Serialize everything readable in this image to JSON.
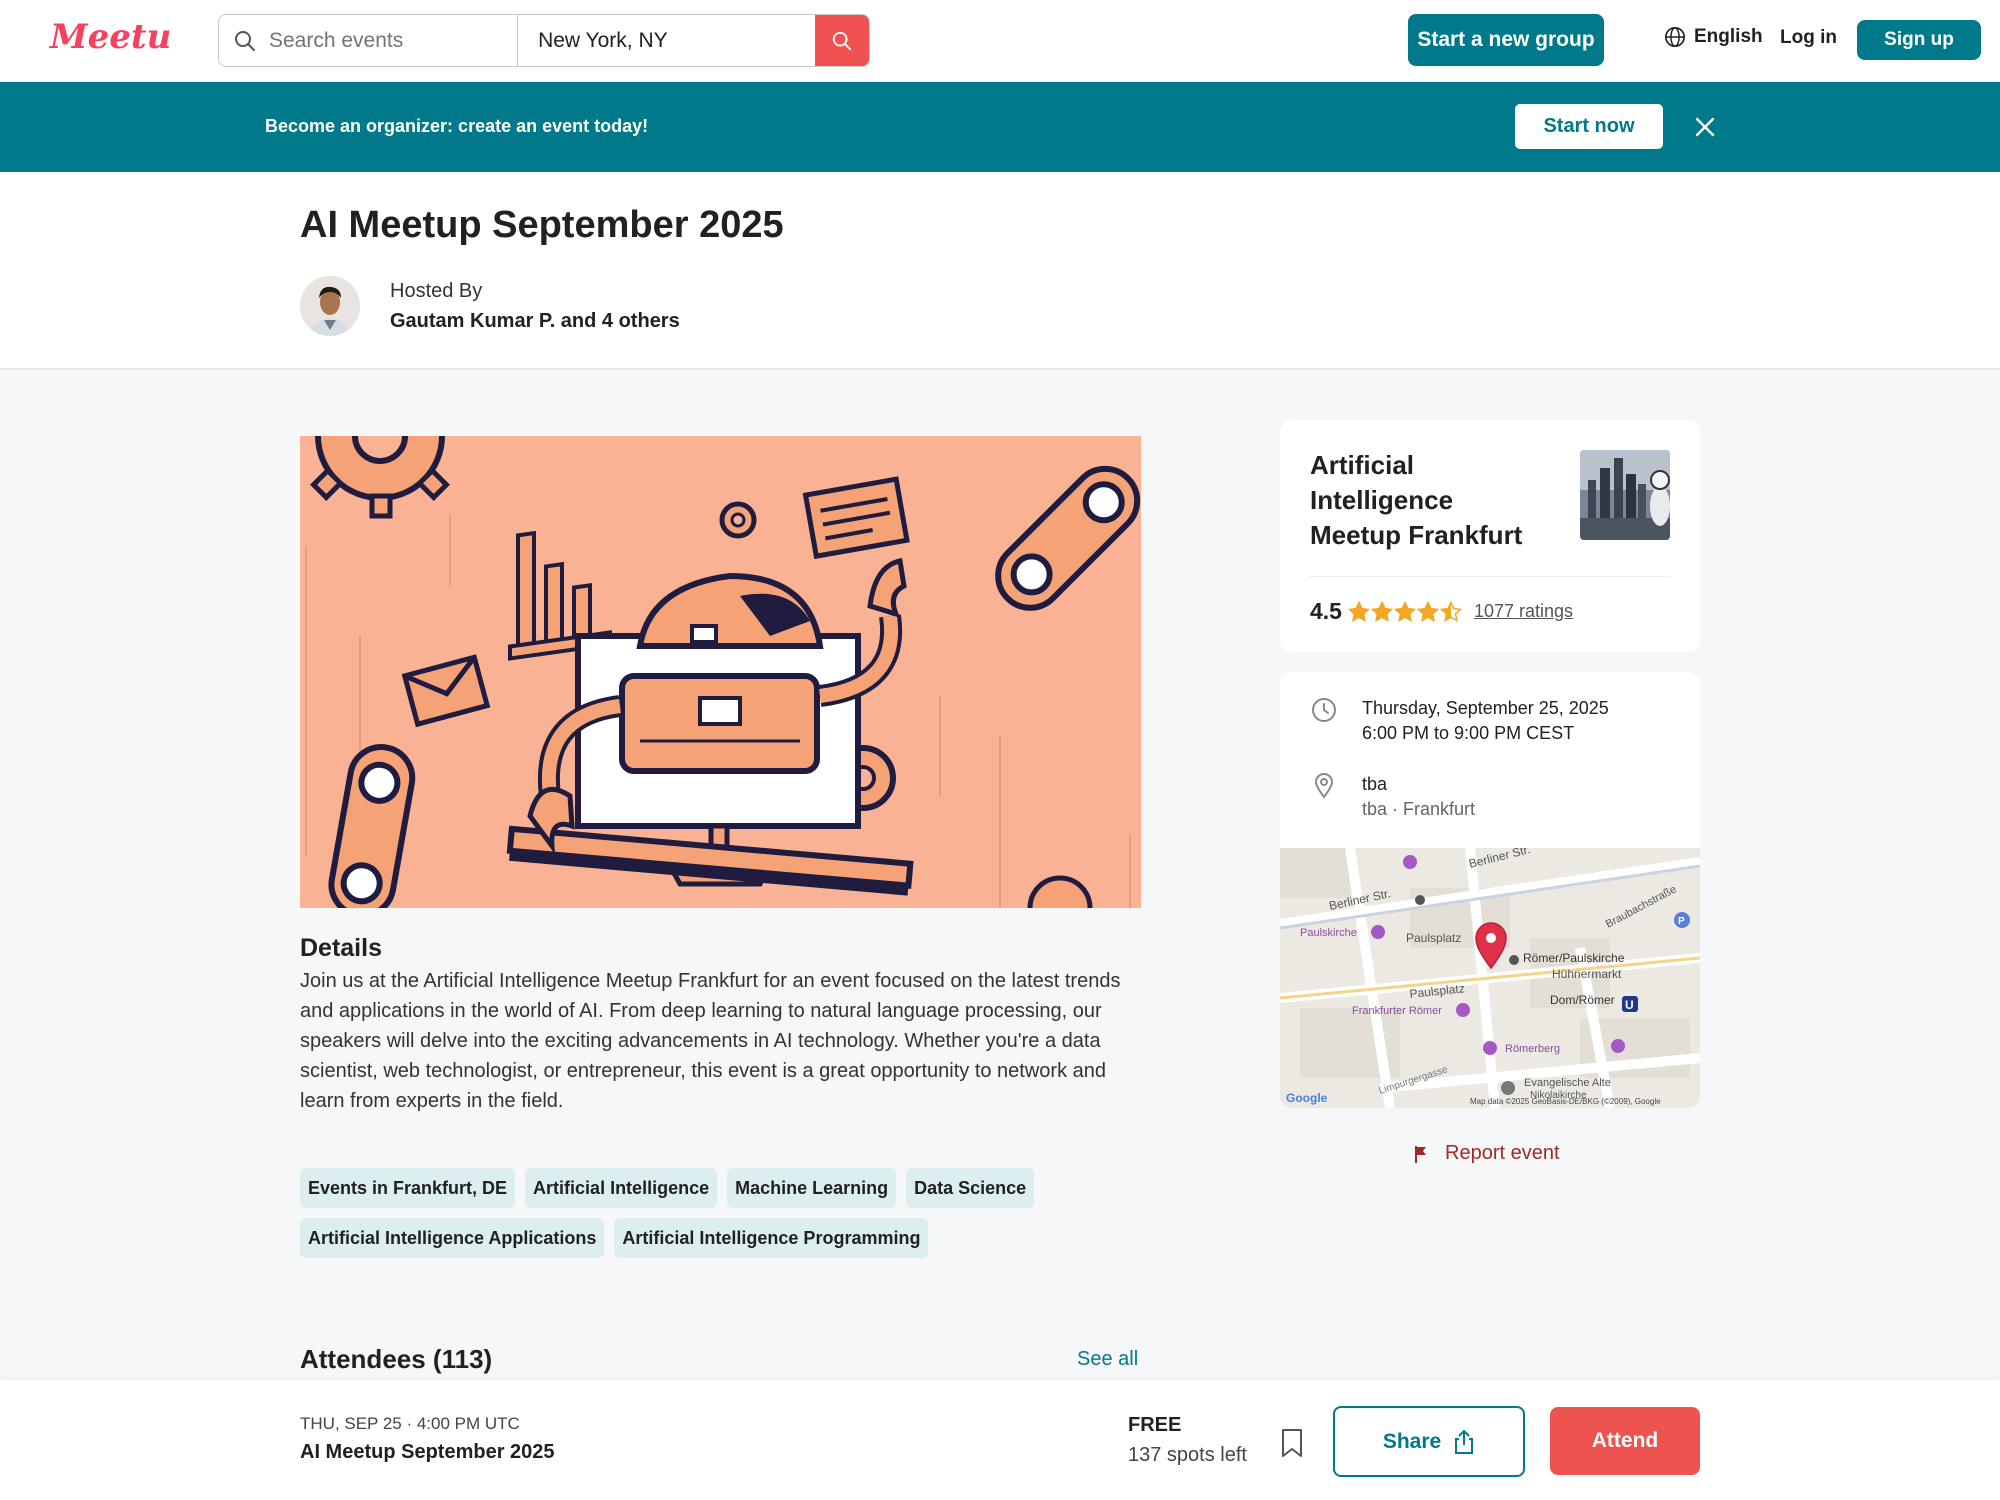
{
  "nav": {
    "logo_text": "Meetup",
    "search_placeholder": "Search events",
    "location_value": "New York, NY",
    "start_group_label": "Start a new group",
    "language_label": "English",
    "login_label": "Log in",
    "signup_label": "Sign up",
    "brand_color": "#f64060",
    "accent_color": "#00798a"
  },
  "banner": {
    "text": "Become an organizer: create an event today!",
    "button_label": "Start now"
  },
  "event": {
    "title": "AI Meetup September 2025",
    "hosted_by_label": "Hosted By",
    "host_name": "Gautam Kumar P. and 4 others"
  },
  "details": {
    "title": "Details",
    "body": "Join us at the Artificial Intelligence Meetup Frankfurt for an event focused on the latest trends and applications in the world of AI. From deep learning to natural language processing, our speakers will delve into the exciting advancements in AI technology. Whether you're a data scientist, web technologist, or entrepreneur, this event is a great opportunity to network and learn from experts in the field."
  },
  "tags": [
    "Events in Frankfurt, DE",
    "Artificial Intelligence",
    "Machine Learning",
    "Data Science",
    "Artificial Intelligence Applications",
    "Artificial Intelligence Programming"
  ],
  "attendees": {
    "title": "Attendees (113)",
    "see_all_label": "See all"
  },
  "group": {
    "name": "Artificial Intelligence Meetup Frankfurt",
    "rating": "4.5",
    "stars": 4.5,
    "ratings_label": "1077 ratings"
  },
  "info": {
    "date": "Thursday, September 25, 2025",
    "time": "6:00 PM to 9:00 PM CEST",
    "venue": "tba",
    "venue_sub": "tba · Frankfurt"
  },
  "map": {
    "labels": {
      "berliner_str_1": "Berliner Str.",
      "berliner_str_2": "Berliner Str.",
      "paulskirche": "Paulskirche",
      "paulsplatz_1": "Paulsplatz",
      "paulsplatz_2": "Paulsplatz",
      "roemer_paulskirche": "Römer/Paulskirche",
      "huehnermarkt": "Hühnermarkt",
      "dom_roemer": "Dom/Römer",
      "frankfurter_roemer": "Frankfurter Römer",
      "roemerberg": "Römerberg",
      "braubachstrasse": "Braubachstraße",
      "limpurgergasse": "Limpurgergasse",
      "evangelische": "Evangelische Alte",
      "nikolaikirche": "Nikolaikirche",
      "google": "Google",
      "attribution": "Map data ©2025 GeoBasis-DE/BKG (©2009), Google"
    }
  },
  "report_label": "Report event",
  "bottom_bar": {
    "date": "THU, SEP 25 · 4:00 PM UTC",
    "title": "AI Meetup September 2025",
    "price": "FREE",
    "spots": "137 spots left",
    "share_label": "Share",
    "attend_label": "Attend",
    "attend_color": "#ef5350"
  }
}
